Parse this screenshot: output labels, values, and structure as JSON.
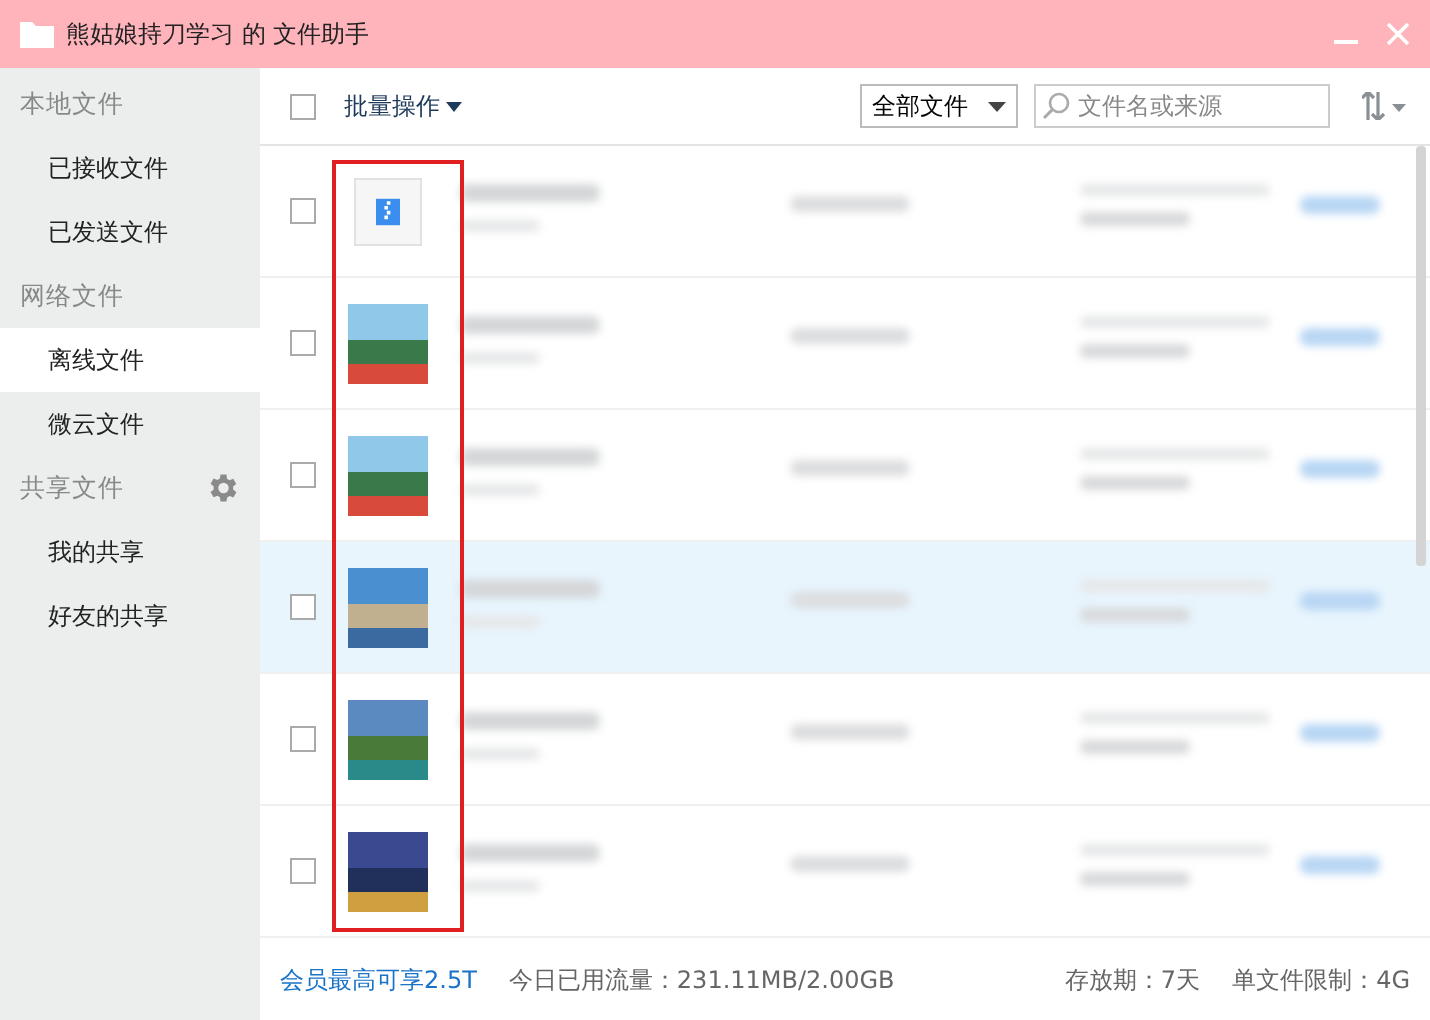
{
  "window": {
    "title": "熊姑娘持刀学习 的 文件助手"
  },
  "sidebar": {
    "sections": [
      {
        "label": "本地文件",
        "settings": false,
        "items": [
          {
            "label": "已接收文件",
            "selected": false
          },
          {
            "label": "已发送文件",
            "selected": false
          }
        ]
      },
      {
        "label": "网络文件",
        "settings": false,
        "items": [
          {
            "label": "离线文件",
            "selected": true
          },
          {
            "label": "微云文件",
            "selected": false
          }
        ]
      },
      {
        "label": "共享文件",
        "settings": true,
        "items": [
          {
            "label": "我的共享",
            "selected": false
          },
          {
            "label": "好友的共享",
            "selected": false
          }
        ]
      }
    ]
  },
  "toolbar": {
    "select_all_checked": false,
    "batch_label": "批量操作",
    "filter": "全部文件",
    "search": {
      "placeholder": "文件名或来源"
    }
  },
  "files": [
    {
      "kind": "archive",
      "checked": false,
      "selected": false
    },
    {
      "kind": "photo",
      "checked": false,
      "selected": false
    },
    {
      "kind": "photo",
      "checked": false,
      "selected": false
    },
    {
      "kind": "photo",
      "checked": false,
      "selected": true
    },
    {
      "kind": "photo",
      "checked": false,
      "selected": false
    },
    {
      "kind": "photo",
      "checked": false,
      "selected": false
    }
  ],
  "status_bar": {
    "promo": "会员最高可享2.5T",
    "traffic": "今日已用流量：231.11MB/2.00GB",
    "retention": "存放期：7天",
    "limit": "单文件限制：4G"
  }
}
